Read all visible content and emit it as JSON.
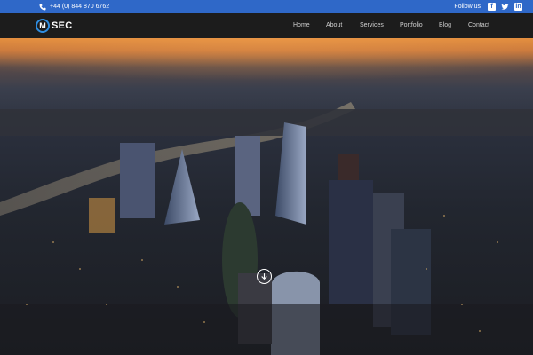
{
  "topbar": {
    "phone_icon": "phone-icon",
    "phone": "+44 (0) 844 870 6762",
    "follow_label": "Follow us",
    "social": [
      "facebook-icon",
      "twitter-icon",
      "linkedin-icon"
    ]
  },
  "brand": {
    "mark": "M",
    "text": "SEC"
  },
  "nav": {
    "items": [
      "Home",
      "About",
      "Services",
      "Portfolio",
      "Blog",
      "Contact"
    ]
  },
  "hero": {
    "scroll_icon": "arrow-down-circle-icon"
  },
  "colors": {
    "topbar": "#2f68c8",
    "navbar": "#1c1c1c",
    "logo_accent": "#2f8de0"
  }
}
